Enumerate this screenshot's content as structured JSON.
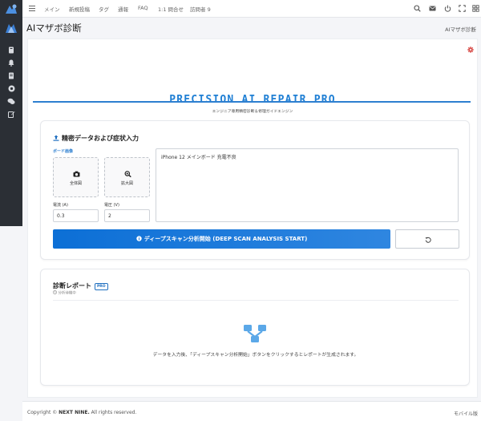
{
  "colors": {
    "accent": "#1f7fd4",
    "sidebar_bg": "#2b2f35",
    "danger": "#d9534f"
  },
  "nav": {
    "items": [
      "メイン",
      "新規投稿",
      "タグ",
      "通報",
      "FAQ",
      "1:1 問合せ",
      "訪問者 9"
    ]
  },
  "page": {
    "title": "AIマザボ診断",
    "breadcrumb": "AIマザボ診断"
  },
  "hero": {
    "title": "PRECISION AI REPAIR PRO",
    "subtitle": "エンジニア専用精密診断＆修理ガイドエンジン"
  },
  "input_card": {
    "title": "精密データおよび症状入力",
    "board_image_label": "ボード画像",
    "full_view_label": "全体図",
    "zoom_view_label": "拡大図",
    "current_label": "電流 (A)",
    "current_value": "0.3",
    "voltage_label": "電圧 (V)",
    "voltage_value": "2",
    "symptom_text": "iPhone 12 メインボード 充電不良",
    "scan_button": "ディープスキャン分析開始 (DEEP SCAN ANALYSIS START)"
  },
  "report_card": {
    "title": "診断レポート",
    "badge": "PRO",
    "status": "分析待機中",
    "empty_message": "データを入力後、「ディープスキャン分析開始」ボタンをクリックするとレポートが生成されます。"
  },
  "footer": {
    "copyright_prefix": "Copyright © ",
    "brand": "NEXT NINE.",
    "copyright_suffix": " All rights reserved.",
    "mobile_link": "モバイル版"
  }
}
